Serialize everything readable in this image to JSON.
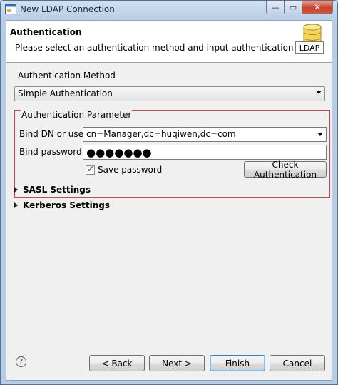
{
  "window": {
    "title": "New LDAP Connection",
    "minimize_glyph": "—",
    "maximize_glyph": "▭",
    "close_glyph": "✕"
  },
  "banner": {
    "title": "Authentication",
    "description": "Please select an authentication method and input authentication data.",
    "icon_label": "LDAP"
  },
  "method": {
    "group_label": "Authentication Method",
    "selected": "Simple Authentication"
  },
  "params": {
    "group_label": "Authentication Parameter",
    "bind_dn_label": "Bind DN or user:",
    "bind_dn_value": "cn=Manager,dc=huqiwen,dc=com",
    "bind_password_label": "Bind password:",
    "bind_password_mask": "●●●●●●●",
    "save_password_label": "Save password",
    "save_password_checked": true,
    "check_button": "Check Authentication"
  },
  "sections": {
    "sasl": "SASL Settings",
    "kerberos": "Kerberos Settings"
  },
  "footer": {
    "help_glyph": "?",
    "back": "< Back",
    "next": "Next >",
    "finish": "Finish",
    "cancel": "Cancel"
  },
  "colors": {
    "highlight_border": "#d94040",
    "title_bar": "#b7cde6"
  }
}
